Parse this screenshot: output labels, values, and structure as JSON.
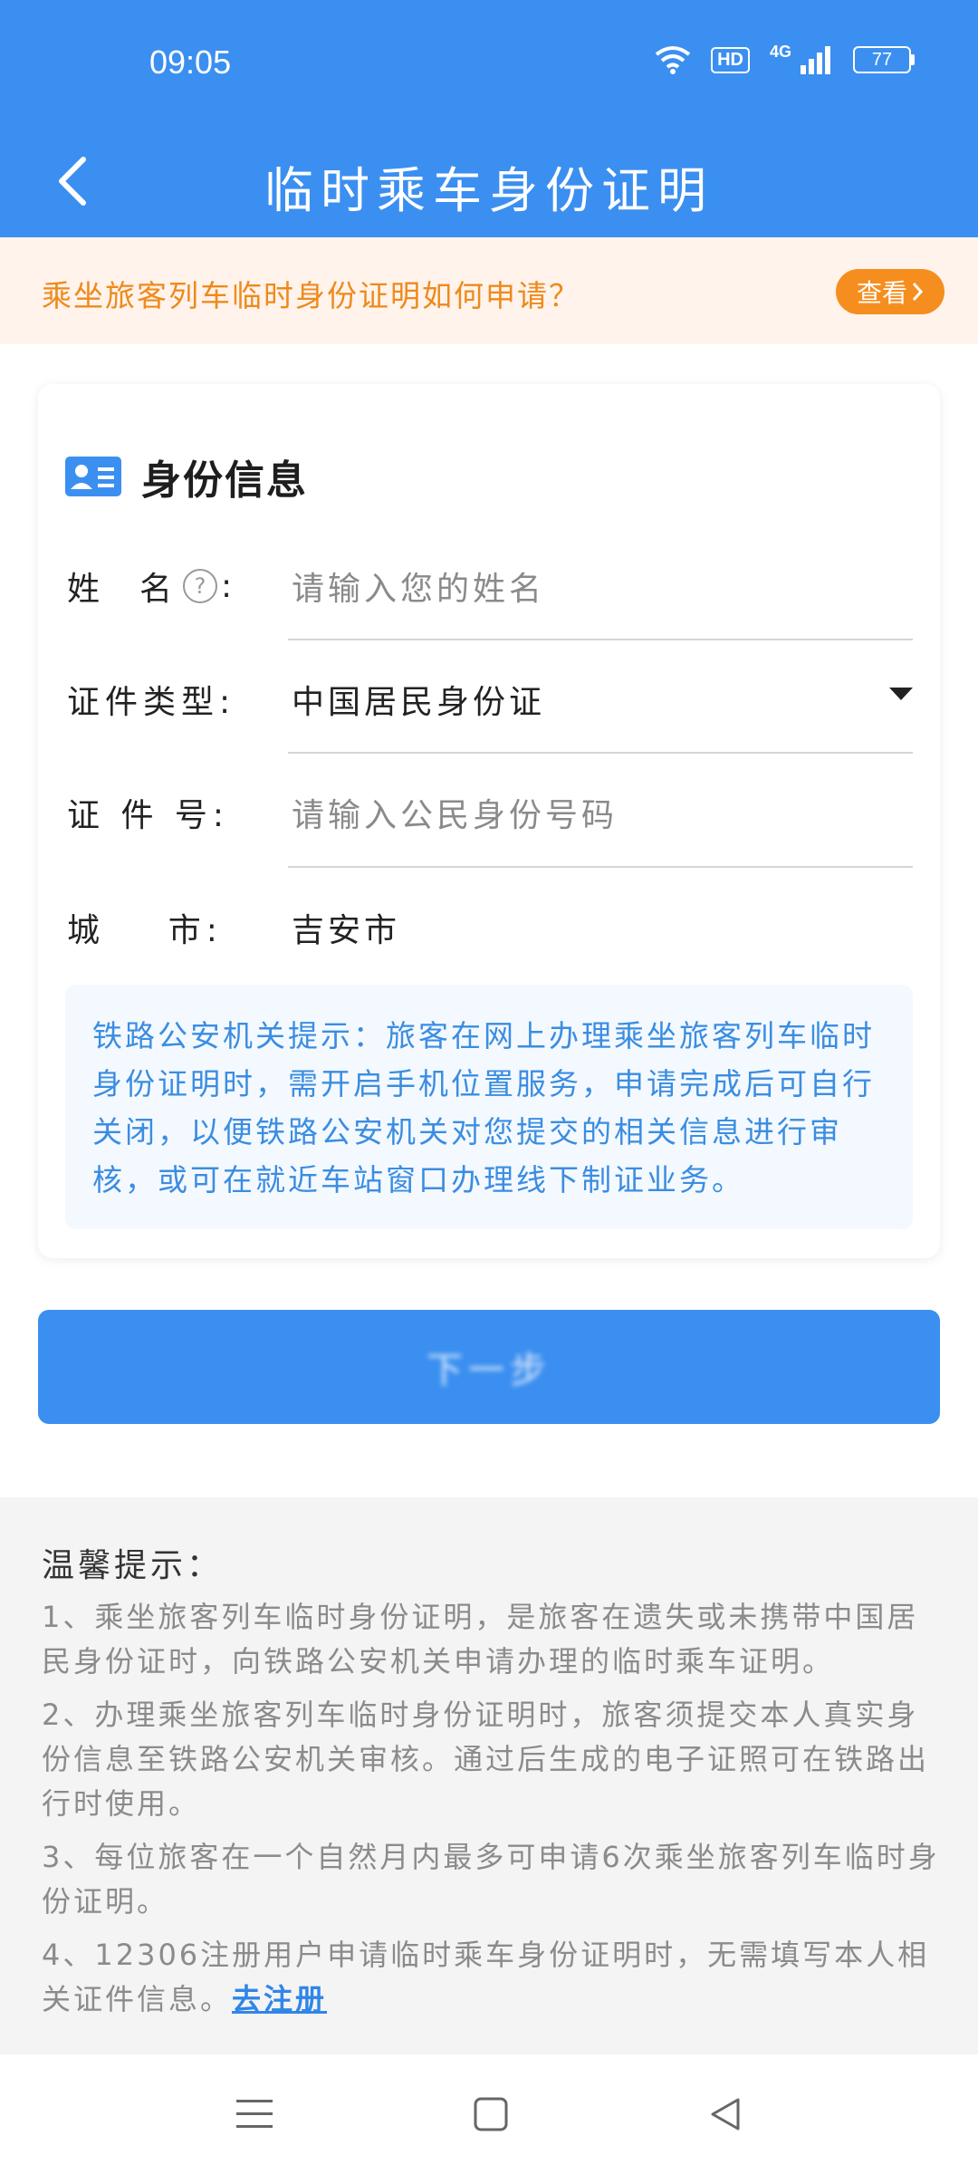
{
  "status_bar": {
    "time": "09:05",
    "hd_badge": "HD",
    "network": "4G",
    "battery": "77"
  },
  "app_bar": {
    "title": "临时乘车身份证明"
  },
  "notice": {
    "text": "乘坐旅客列车临时身份证明如何申请？",
    "button_label": "查看"
  },
  "identity_section": {
    "title": "身份信息",
    "name": {
      "label_part1": "姓",
      "label_part2": "名",
      "colon": ":",
      "help": "?",
      "placeholder": "请输入您的姓名"
    },
    "id_type": {
      "label": "证件类型:",
      "value": "中国居民身份证"
    },
    "id_number": {
      "label": "证 件 号:",
      "placeholder": "请输入公民身份号码"
    },
    "city": {
      "label": "城    市:",
      "value": "吉安市"
    },
    "tip": "铁路公安机关提示：旅客在网上办理乘坐旅客列车临时身份证明时，需开启手机位置服务，申请完成后可自行关闭，以便铁路公安机关对您提交的相关信息进行审核，或可在就近车站窗口办理线下制证业务。"
  },
  "submit": {
    "label": "下一步"
  },
  "warm_tips": {
    "title": "温馨提示：",
    "items": [
      "1、乘坐旅客列车临时身份证明，是旅客在遗失或未携带中国居民身份证时，向铁路公安机关申请办理的临时乘车证明。",
      "2、办理乘坐旅客列车临时身份证明时，旅客须提交本人真实身份信息至铁路公安机关审核。通过后生成的电子证照可在铁路出行时使用。",
      "3、每位旅客在一个自然月内最多可申请6次乘坐旅客列车临时身份证明。",
      "4、12306注册用户申请临时乘车身份证明时，无需填写本人相关证件信息。"
    ],
    "register_link": "去注册"
  },
  "colors": {
    "primary": "#3b8ff0",
    "accent_orange": "#f58d1f",
    "tip_blue": "#3a8de0"
  }
}
